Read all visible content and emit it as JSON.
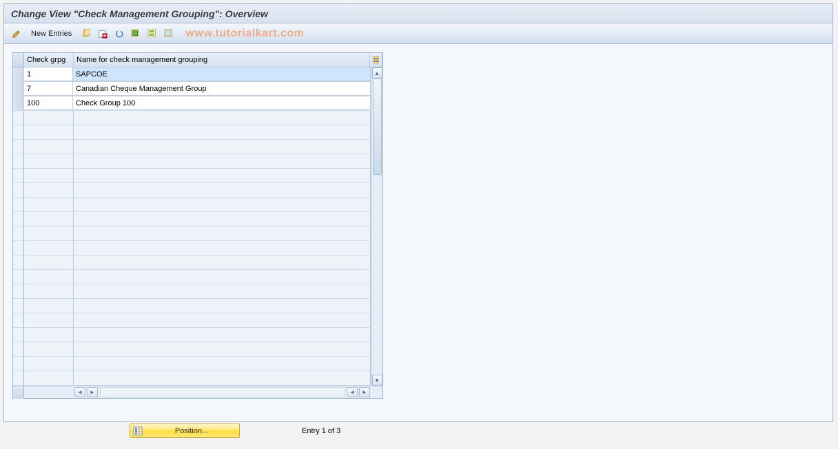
{
  "title": "Change View \"Check Management Grouping\": Overview",
  "toolbar": {
    "new_entries_label": "New Entries"
  },
  "watermark": "www.tutorialkart.com",
  "table": {
    "columns": {
      "grpg": "Check grpg",
      "name": "Name for check management grouping"
    },
    "rows": [
      {
        "grpg": "1",
        "name": "SAPCOE",
        "name_selected": true
      },
      {
        "grpg": "7",
        "name": "Canadian Cheque Management Group"
      },
      {
        "grpg": "100",
        "name": "Check Group 100"
      }
    ],
    "empty_row_count": 19
  },
  "footer": {
    "position_label": "Position...",
    "entry_text": "Entry 1 of 3"
  }
}
